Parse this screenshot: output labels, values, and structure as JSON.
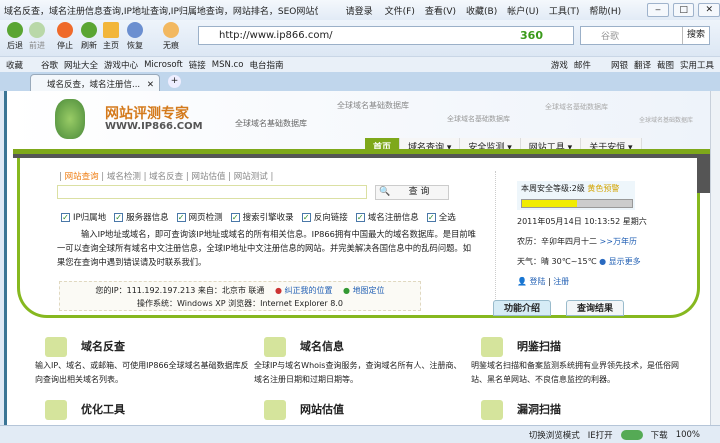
{
  "window": {
    "title": "域名反查，域名注册信息查询,IP地址查询,IP归属地查询，网站排名，SEO网站优化,...",
    "login": "请登录",
    "menu": [
      "文件(F)",
      "查看(V)",
      "收藏(B)",
      "帐户(U)",
      "工具(T)",
      "帮助(H)"
    ]
  },
  "toolbar": {
    "buttons": [
      "后退",
      "前进",
      "停止",
      "刷新",
      "主页",
      "恢复",
      "无痕"
    ],
    "url": "http://www.ip866.com/",
    "brand": "360",
    "search_placeholder": "谷歌",
    "search_button": "搜索"
  },
  "favorites": {
    "left": [
      "收藏",
      "谷歌",
      "网址大全",
      "游戏中心",
      "Microsoft",
      "链接",
      "MSN.co",
      "电台指南"
    ],
    "right": [
      "游戏",
      "邮件",
      "",
      "网银",
      "翻译",
      "截图",
      "实用工具"
    ]
  },
  "tab": {
    "label": "域名反查，域名注册信..."
  },
  "site": {
    "logo_cn": "网站评测专家",
    "logo_en": "WWW.IP866.COM",
    "slogan": "全球域名基础数据库",
    "nav": [
      "首页",
      "域名查询 ▾",
      "安全监测 ▾",
      "网站工具 ▾",
      "关于安恒 ▾"
    ],
    "query_tabs": [
      "网站查询",
      "域名检测",
      "域名反查",
      "网站估值",
      "网站测试"
    ],
    "query_button": "查 询",
    "checks": [
      "IP归属地",
      "服务器信息",
      "网页检测",
      "搜索引擎收录",
      "反向链接",
      "域名注册信息",
      "全选"
    ],
    "description": "输入IP地址或域名，即可查询该IP地址或域名的所有相关信息。IP866拥有中国最大的域名数据库。是目前唯一可以查询全球所有域名中文注册信息，全球IP地址中文注册信息的网站。并完美解决各国信息中的乱码问题。如果您在查询中遇到错误请及时联系我们。",
    "ip_line": "您的IP：111.192.197.213 来自：北京市 联通",
    "fix_location": "纠正我的位置",
    "map_locate": "地图定位",
    "os_line": "操作系统：Windows XP  浏览器：Internet Explorer 8.0",
    "security_level": "本周安全等级:2级",
    "security_warn": "黄色预警",
    "security_fill": 0.5,
    "datetime": "2011年05月14日 10:13:52 星期六",
    "lunar": "农历：辛卯年四月十二",
    "calendar_link": ">>万年历",
    "weather": "天气：晴 30℃~15℃",
    "weather_more": "显示更多",
    "login": "登陆",
    "register": "注册",
    "tabs": [
      "功能介绍",
      "查询结果"
    ],
    "features": [
      {
        "title": "域名反查",
        "desc": "输入IP、域名、或邮箱、可使用IP866全球域名基础数据库反向查询出相关域名列表。"
      },
      {
        "title": "域名信息",
        "desc": "全球IP与域名Whois查询服务，查询域名所有人、注册商、域名注册日期和过期日期等。"
      },
      {
        "title": "明鉴扫描",
        "desc": "明鉴域名扫描和备案监测系统拥有业界领先技术，是低俗网站、黑名单网站、不良信息监控的利器。"
      },
      {
        "title": "优化工具",
        "desc": ""
      },
      {
        "title": "网站估值",
        "desc": ""
      },
      {
        "title": "漏洞扫描",
        "desc": ""
      }
    ]
  },
  "status": {
    "switch_mode": "切换浏览模式",
    "ie_open": "IE打开",
    "download": "下载",
    "zoom": "100%"
  }
}
